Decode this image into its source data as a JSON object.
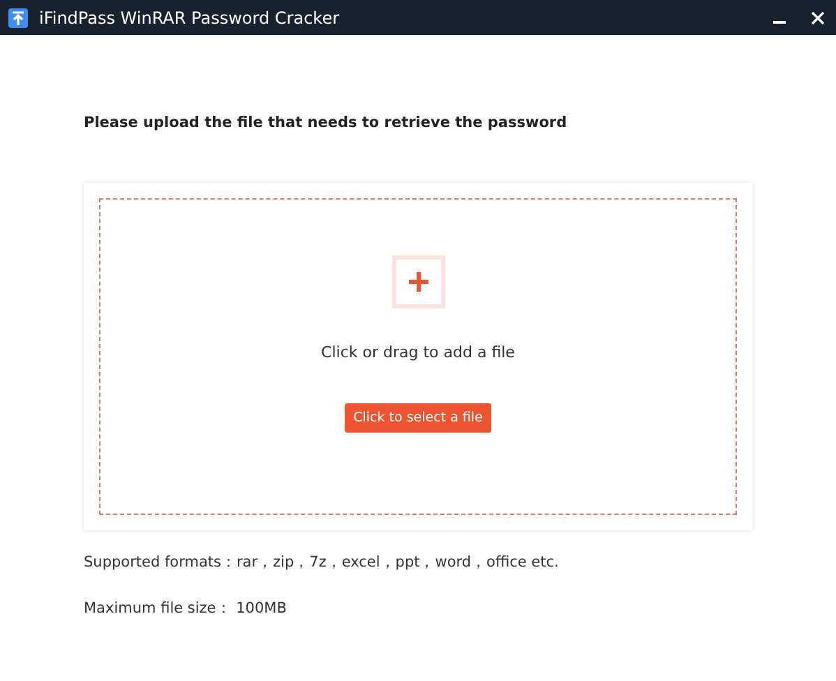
{
  "window": {
    "title": "iFindPass WinRAR Password Cracker"
  },
  "heading": "Please upload the file that needs to retrieve the password",
  "upload": {
    "hint": "Click or drag to add a file",
    "button": "Click to select a file"
  },
  "notes": [
    "Supported formats：rar，zip，7z，excel，ppt，word，office etc.",
    "Maximum file size：  100MB"
  ]
}
